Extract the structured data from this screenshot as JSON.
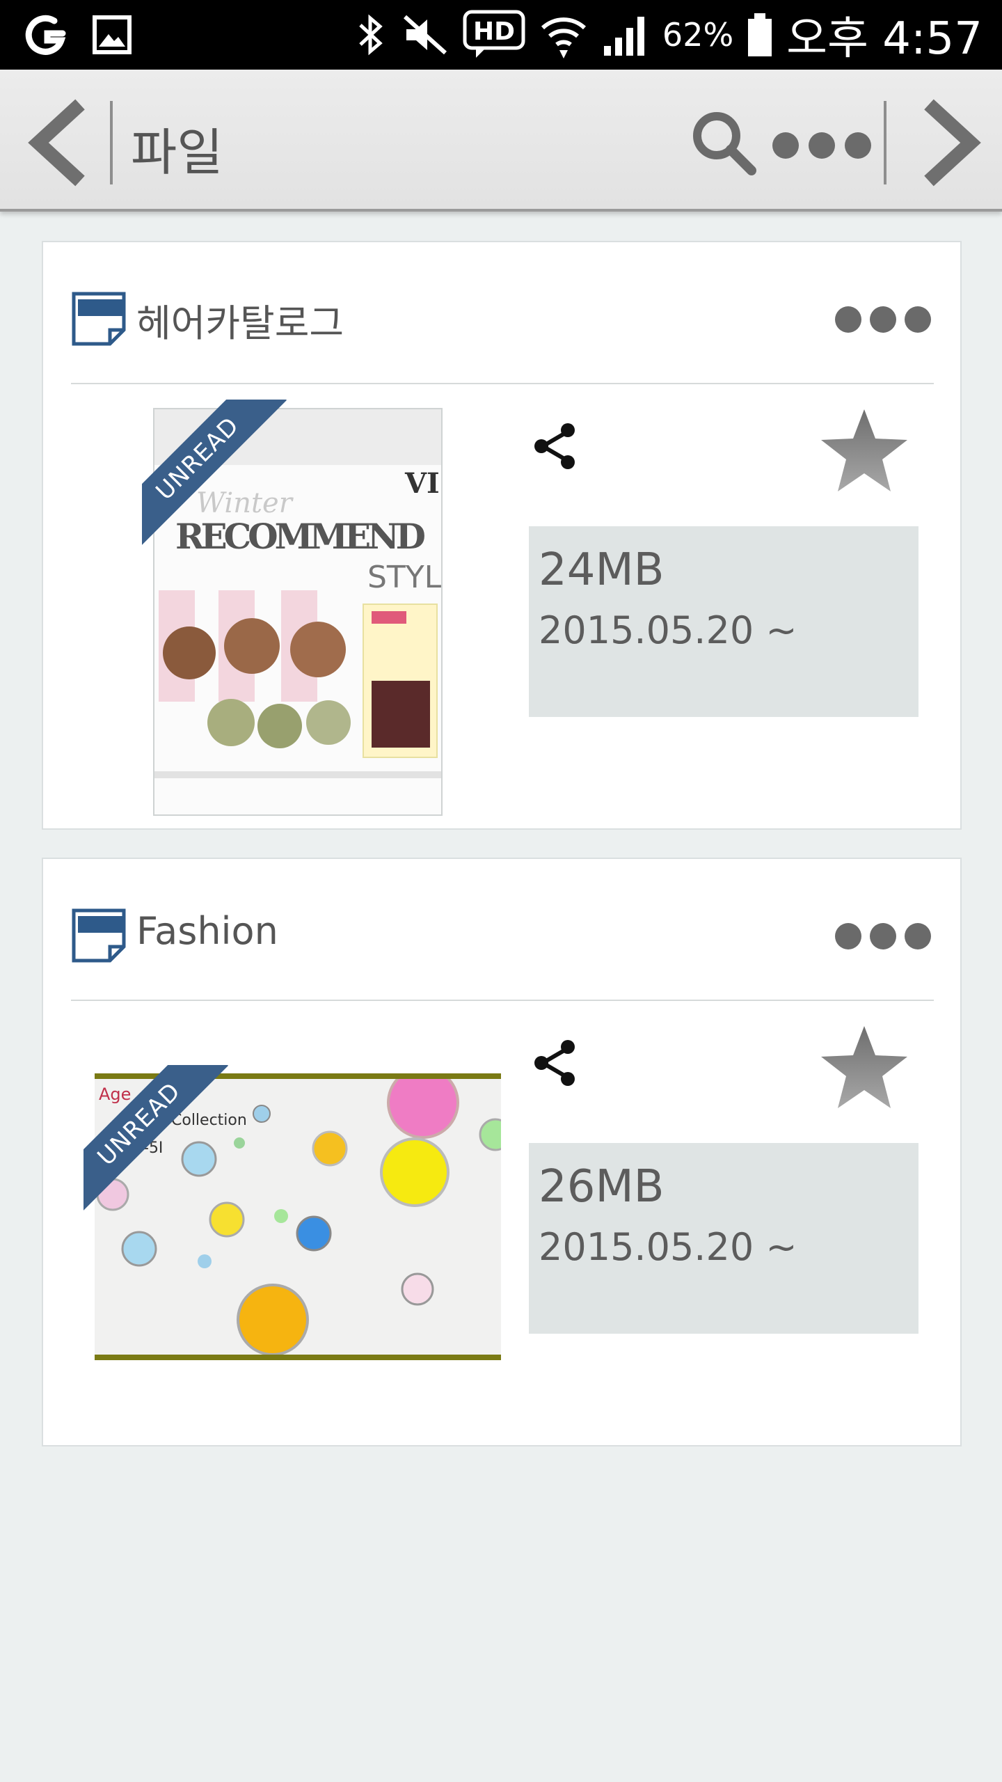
{
  "status_bar": {
    "battery": "62%",
    "time": "오후 4:57"
  },
  "action_bar": {
    "title": "파일"
  },
  "files": [
    {
      "title": "헤어카탈로그",
      "badge": "UNREAD",
      "size": "24MB",
      "date": "2015.05.20 ~",
      "thumb_text": [
        "Winter",
        "RECOMMEND",
        "STYLE",
        "VI"
      ]
    },
    {
      "title": "Fashion",
      "badge": "UNREAD",
      "size": "26MB",
      "date": "2015.05.20 ~",
      "thumb_text": [
        "Age",
        "Collection",
        "-5I"
      ]
    }
  ],
  "colors": {
    "ribbon": "#3a5f8a",
    "info_box": "#dfe4e4",
    "background": "#ecf0f0",
    "star": "#8a8a8a"
  }
}
